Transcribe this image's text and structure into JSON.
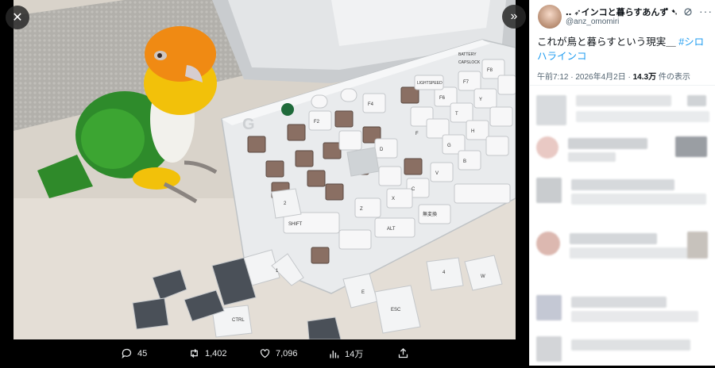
{
  "viewer": {
    "close_icon": "close-icon",
    "expand_icon": "chevron-right-double-icon"
  },
  "photo": {
    "description_icon": "photo",
    "key_labels": {
      "shift": "SHIFT",
      "ctrl": "CTRL",
      "alt": "ALT",
      "henkan": "無変換",
      "lightspeed": "LIGHTSPEED",
      "battery": "BATTERY",
      "capslock": "CAPSLOCK",
      "esc": "ESC",
      "z": "Z",
      "x": "X",
      "c": "C",
      "v": "V",
      "b": "B",
      "d": "D",
      "f": "F",
      "g": "G",
      "t": "T",
      "y": "Y",
      "h": "H",
      "f2": "F2",
      "f4": "F4",
      "f6": "F6",
      "f7": "F7",
      "f8": "F8",
      "w": "W",
      "e": "E",
      "four": "4",
      "one": "1",
      "two": "2"
    }
  },
  "actions": {
    "replies": "45",
    "retweets": "1,402",
    "likes": "7,096",
    "views": "14万"
  },
  "tweet": {
    "display_name": "‥ ➶インコと暮らすあんず ➷‥",
    "handle": "@anz_omomiri",
    "text_main": "これが鳥と暮らすという現実＿ ",
    "text_tag": "#シロハラインコ",
    "time": "午前7:12 · 2026年4月2日 · ",
    "views_count": "14.3万",
    "views_label": " 件の表示"
  }
}
